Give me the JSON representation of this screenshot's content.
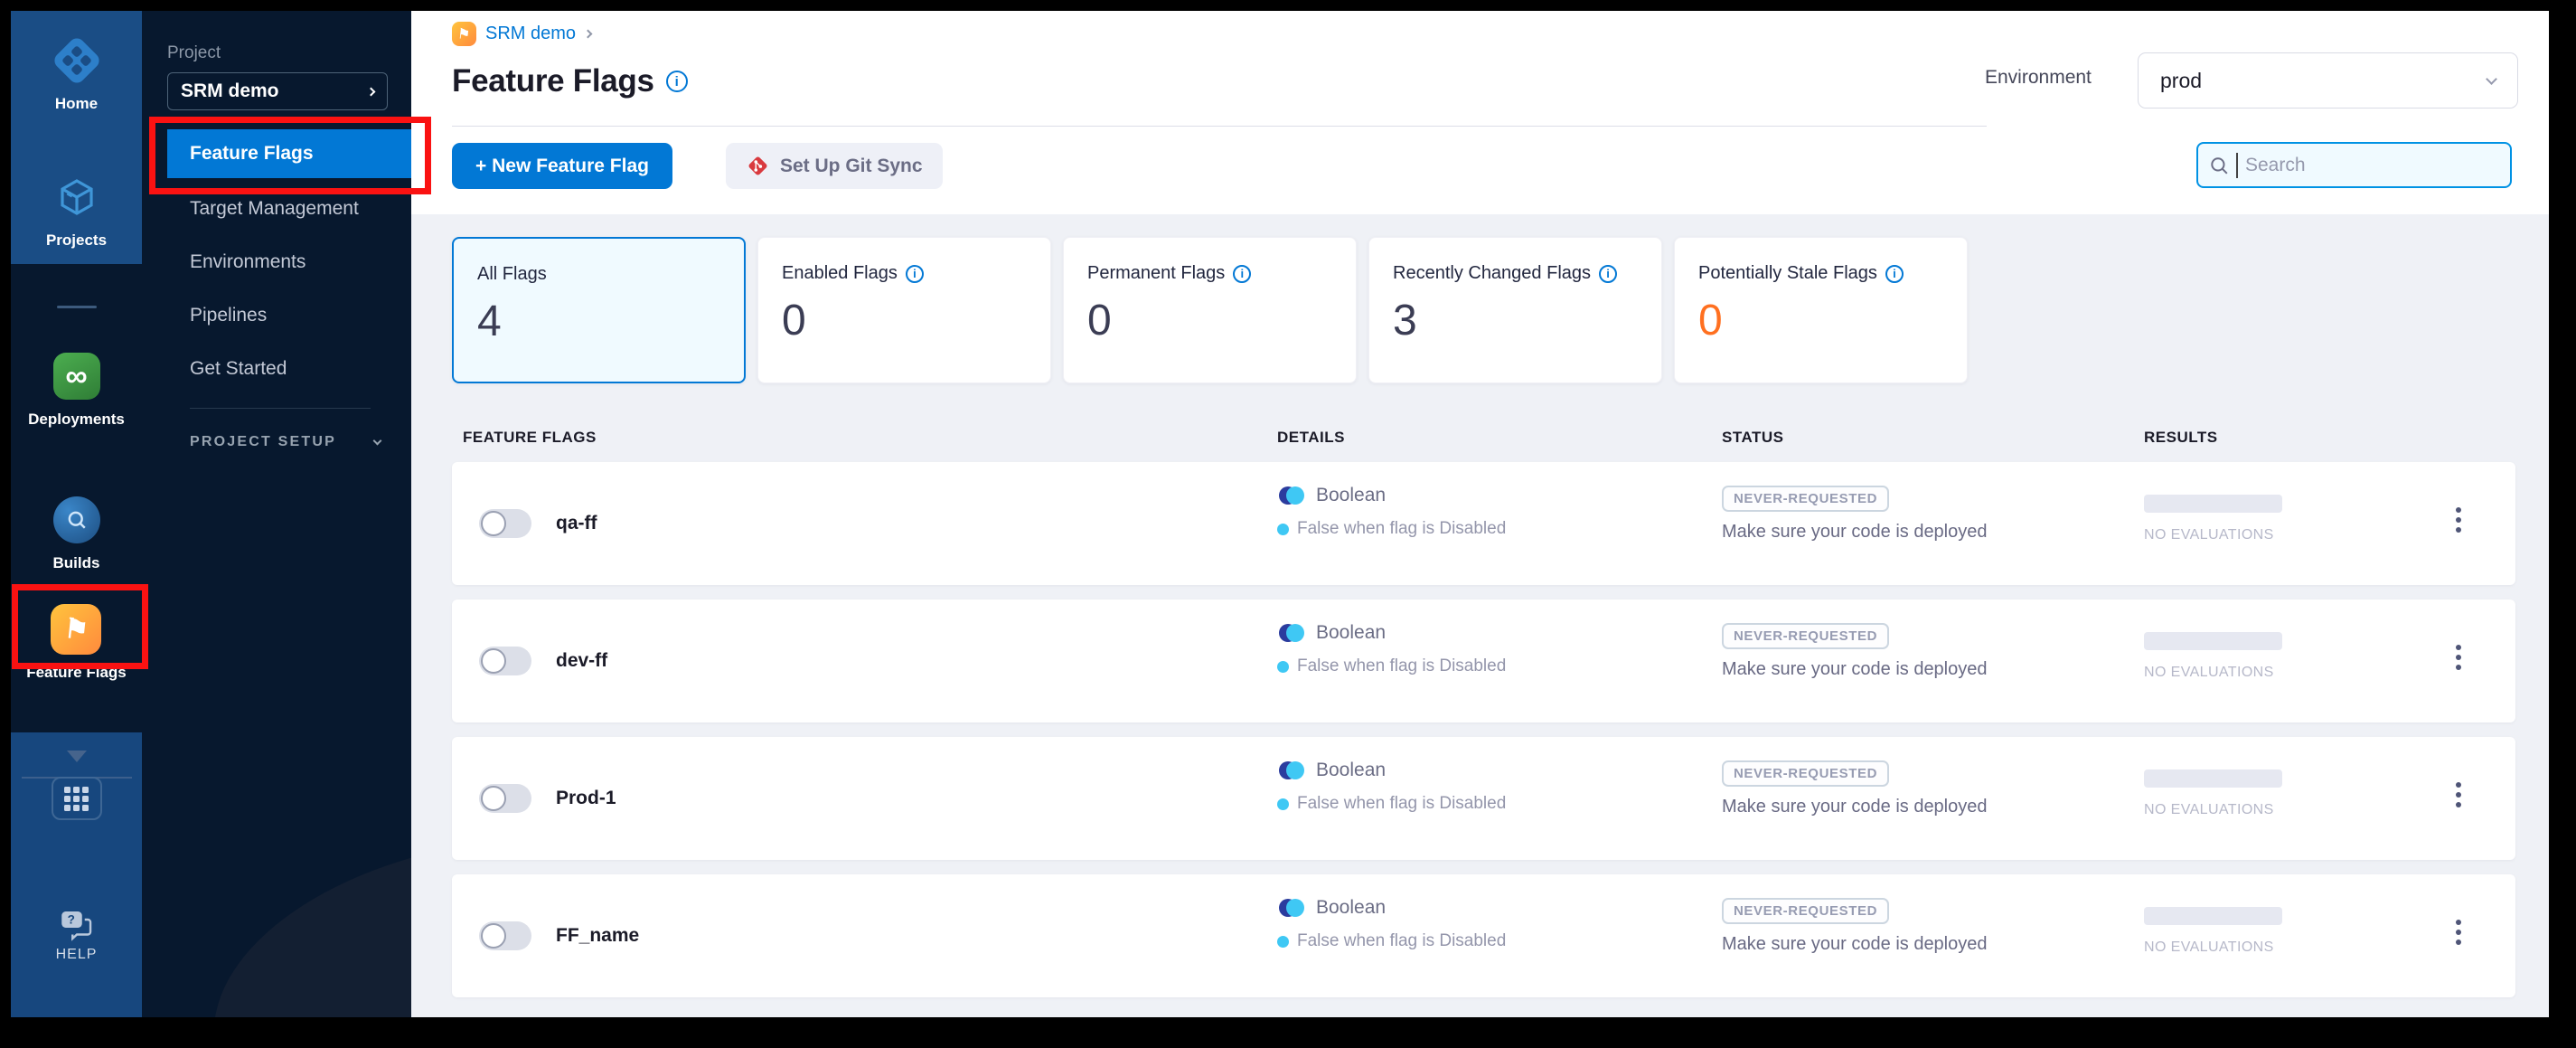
{
  "colors": {
    "accent_blue": "#0278d5",
    "rail_blue": "#1a4d85",
    "nav_dark": "#07182e",
    "content_bg": "#eff1f6",
    "stale_orange": "#ff7020",
    "boolean_cyan": "#3fc8f4",
    "boolean_navy": "#2b3c9e",
    "annotation_red": "#fa1212"
  },
  "module_nav": {
    "items": [
      {
        "label": "Home",
        "icon": "harness-home-icon"
      },
      {
        "label": "Projects",
        "icon": "projects-cube-icon"
      },
      {
        "label": "Deployments",
        "icon": "deployments-icon"
      },
      {
        "label": "Builds",
        "icon": "builds-icon"
      },
      {
        "label": "Feature Flags",
        "icon": "feature-flags-icon"
      }
    ],
    "help_label": "HELP"
  },
  "project_nav": {
    "section_label": "Project",
    "project_name": "SRM demo",
    "items": [
      "Feature Flags",
      "Target Management",
      "Environments",
      "Pipelines",
      "Get Started"
    ],
    "active_item": "Feature Flags",
    "setup_label": "PROJECT SETUP"
  },
  "header": {
    "breadcrumb_project": "SRM demo",
    "title": "Feature Flags",
    "environment_label": "Environment",
    "environment_value": "prod"
  },
  "toolbar": {
    "new_flag_label": "+ New Feature Flag",
    "git_sync_label": "Set Up Git Sync",
    "search_placeholder": "Search"
  },
  "stats": [
    {
      "label": "All Flags",
      "value": "4",
      "selected": true,
      "info": false
    },
    {
      "label": "Enabled Flags",
      "value": "0",
      "info": true
    },
    {
      "label": "Permanent Flags",
      "value": "0",
      "info": true
    },
    {
      "label": "Recently Changed Flags",
      "value": "3",
      "info": true
    },
    {
      "label": "Potentially Stale Flags",
      "value": "0",
      "info": true,
      "highlight": "orange"
    }
  ],
  "table": {
    "columns": [
      "FEATURE FLAGS",
      "DETAILS",
      "STATUS",
      "RESULTS"
    ],
    "rows": [
      {
        "name": "qa-ff",
        "type": "Boolean",
        "default_rule": "False when flag is Disabled",
        "status_badge": "NEVER-REQUESTED",
        "status_note": "Make sure your code is deployed",
        "results_note": "NO EVALUATIONS",
        "enabled": false
      },
      {
        "name": "dev-ff",
        "type": "Boolean",
        "default_rule": "False when flag is Disabled",
        "status_badge": "NEVER-REQUESTED",
        "status_note": "Make sure your code is deployed",
        "results_note": "NO EVALUATIONS",
        "enabled": false
      },
      {
        "name": "Prod-1",
        "type": "Boolean",
        "default_rule": "False when flag is Disabled",
        "status_badge": "NEVER-REQUESTED",
        "status_note": "Make sure your code is deployed",
        "results_note": "NO EVALUATIONS",
        "enabled": false
      },
      {
        "name": "FF_name",
        "type": "Boolean",
        "default_rule": "False when flag is Disabled",
        "status_badge": "NEVER-REQUESTED",
        "status_note": "Make sure your code is deployed",
        "results_note": "NO EVALUATIONS",
        "enabled": false
      }
    ]
  }
}
